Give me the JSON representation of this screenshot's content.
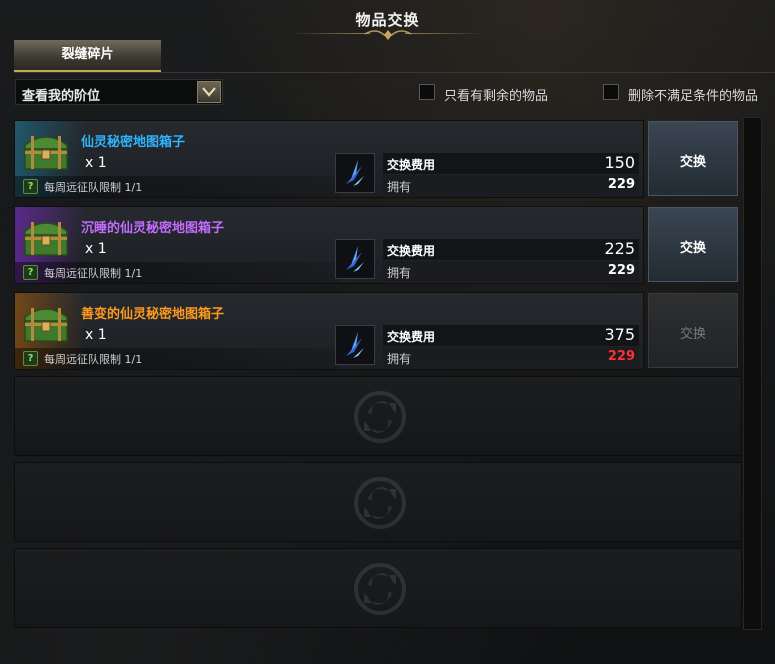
{
  "title": "物品交换",
  "tabs": [
    {
      "label": "裂缝碎片",
      "active": true
    }
  ],
  "filter": {
    "dropdown_value": "查看我的阶位",
    "checkboxes": [
      {
        "label": "只看有剩余的物品",
        "checked": false
      },
      {
        "label": "删除不满足条件的物品",
        "checked": false
      }
    ]
  },
  "items": [
    {
      "name": "仙灵秘密地图箱子",
      "name_color": "#2fb4ff",
      "rarity_glow": "#1f6f8a",
      "quantity": "x 1",
      "limit": "每周远征队限制 1/1",
      "cost_label": "交换费用",
      "cost": "150",
      "owned_label": "拥有",
      "owned": "229",
      "owned_color": "#ffffff",
      "button": "交换",
      "button_enabled": true
    },
    {
      "name": "沉睡的仙灵秘密地图箱子",
      "name_color": "#c26cff",
      "rarity_glow": "#6a2aa8",
      "quantity": "x 1",
      "limit": "每周远征队限制 1/1",
      "cost_label": "交换费用",
      "cost": "225",
      "owned_label": "拥有",
      "owned": "229",
      "owned_color": "#ffffff",
      "button": "交换",
      "button_enabled": true
    },
    {
      "name": "善变的仙灵秘密地图箱子",
      "name_color": "#ff9a1f",
      "rarity_glow": "#8a5210",
      "quantity": "x 1",
      "limit": "每周远征队限制 1/1",
      "cost_label": "交换费用",
      "cost": "375",
      "owned_label": "拥有",
      "owned": "229",
      "owned_color": "#ff3030",
      "button": "交换",
      "button_enabled": false
    }
  ],
  "icons": {
    "dropdown": "chevron-down-icon",
    "help": "question-icon",
    "currency": "blue-crystal-shard-icon",
    "item": "green-treasure-chest-icon",
    "empty_slot": "refresh-cycle-icon"
  }
}
